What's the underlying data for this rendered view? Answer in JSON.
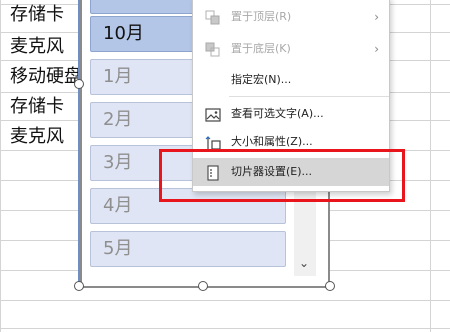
{
  "sheet": {
    "cells": [
      "存储卡",
      "麦克风",
      "移动硬盘",
      "存储卡",
      "麦克风"
    ]
  },
  "slicer": {
    "items": [
      {
        "label": "",
        "selected": true
      },
      {
        "label": "10月",
        "selected": true
      },
      {
        "label": "1月",
        "selected": false
      },
      {
        "label": "2月",
        "selected": false
      },
      {
        "label": "3月",
        "selected": false
      },
      {
        "label": "4月",
        "selected": false
      },
      {
        "label": "5月",
        "selected": false
      }
    ],
    "scroll_icon": "chevron-down-icon"
  },
  "context_menu": {
    "bring_to_front": "置于顶层(R)",
    "send_to_back": "置于底层(K)",
    "assign_macro": "指定宏(N)...",
    "view_alt_text": "查看可选文字(A)...",
    "size_and_properties": "大小和属性(Z)...",
    "slicer_settings": "切片器设置(E)..."
  },
  "colors": {
    "highlight": "#e8161c",
    "selected_item": "#b4c6e7",
    "unselected_item": "#dfe5f4"
  }
}
